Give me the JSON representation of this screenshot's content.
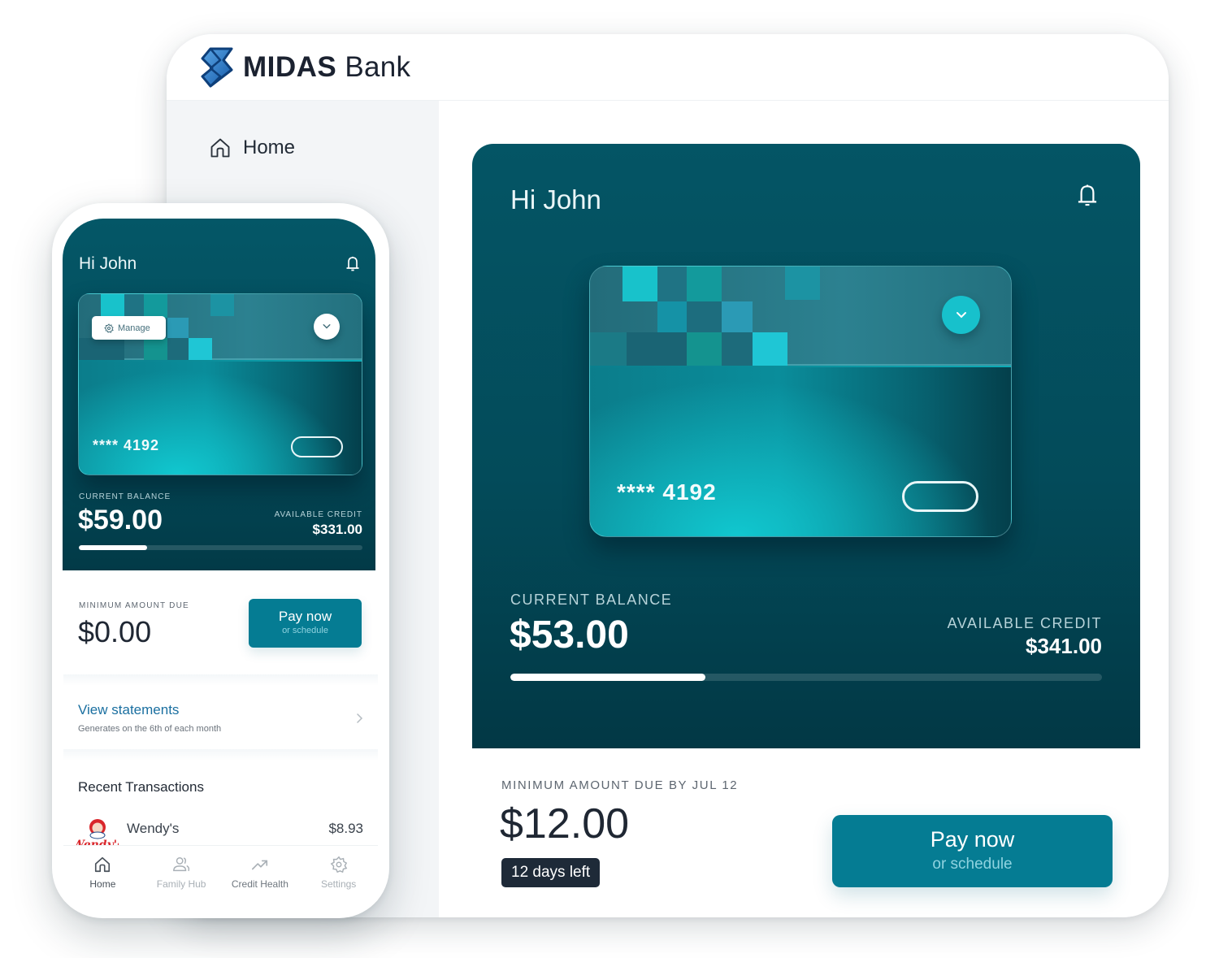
{
  "brand": {
    "name_bold": "MIDAS",
    "name_regular": "Bank",
    "logo_icon": "midas-logo-icon",
    "logo_color": "#1c6fc0"
  },
  "desktop": {
    "sidebar": {
      "items": [
        {
          "label": "Home",
          "icon": "home-icon"
        }
      ]
    },
    "greeting": "Hi John",
    "notification_icon": "bell-icon",
    "card": {
      "masked_number": "**** 4192",
      "expand_icon": "chevron-down-icon"
    },
    "balance": {
      "current_label": "CURRENT BALANCE",
      "current_value": "$53.00",
      "available_label": "AVAILABLE CREDIT",
      "available_value": "$341.00",
      "utilization_percent": 33
    },
    "due": {
      "label": "MINIMUM AMOUNT DUE BY JUL 12",
      "value": "$12.00",
      "days_left": "12 days left"
    },
    "pay_button": {
      "label": "Pay now",
      "sublabel": "or schedule"
    }
  },
  "mobile": {
    "greeting": "Hi John",
    "notification_icon": "bell-icon",
    "card": {
      "manage_label": "Manage",
      "manage_icon": "gear-icon",
      "masked_number": "**** 4192",
      "expand_icon": "chevron-down-icon"
    },
    "balance": {
      "current_label": "CURRENT BALANCE",
      "current_value": "$59.00",
      "available_label": "AVAILABLE CREDIT",
      "available_value": "$331.00",
      "utilization_percent": 24
    },
    "due": {
      "label": "MINIMUM AMOUNT DUE",
      "value": "$0.00"
    },
    "pay_button": {
      "label": "Pay now",
      "sublabel": "or schedule"
    },
    "statements": {
      "title": "View statements",
      "subtitle": "Generates on the 6th of each month"
    },
    "recent_transactions": {
      "title": "Recent Transactions",
      "items": [
        {
          "merchant": "Wendy's",
          "amount": "$8.93",
          "logo": "wendys-logo"
        }
      ]
    },
    "bottom_nav": [
      {
        "label": "Home",
        "icon": "home-icon",
        "active": true
      },
      {
        "label": "Family Hub",
        "icon": "family-icon",
        "active": false
      },
      {
        "label": "Credit Health",
        "icon": "trending-up-icon",
        "active": false
      },
      {
        "label": "Settings",
        "icon": "gear-icon",
        "active": false
      }
    ]
  },
  "colors": {
    "hero_teal": "#045565",
    "accent_teal": "#057c93",
    "chevron_badge": "#17c1cc",
    "dark_badge": "#1e2a38",
    "link_blue": "#1a6fa0",
    "nav_active": "#4a525b",
    "nav_inactive": "#a9b0b6"
  }
}
